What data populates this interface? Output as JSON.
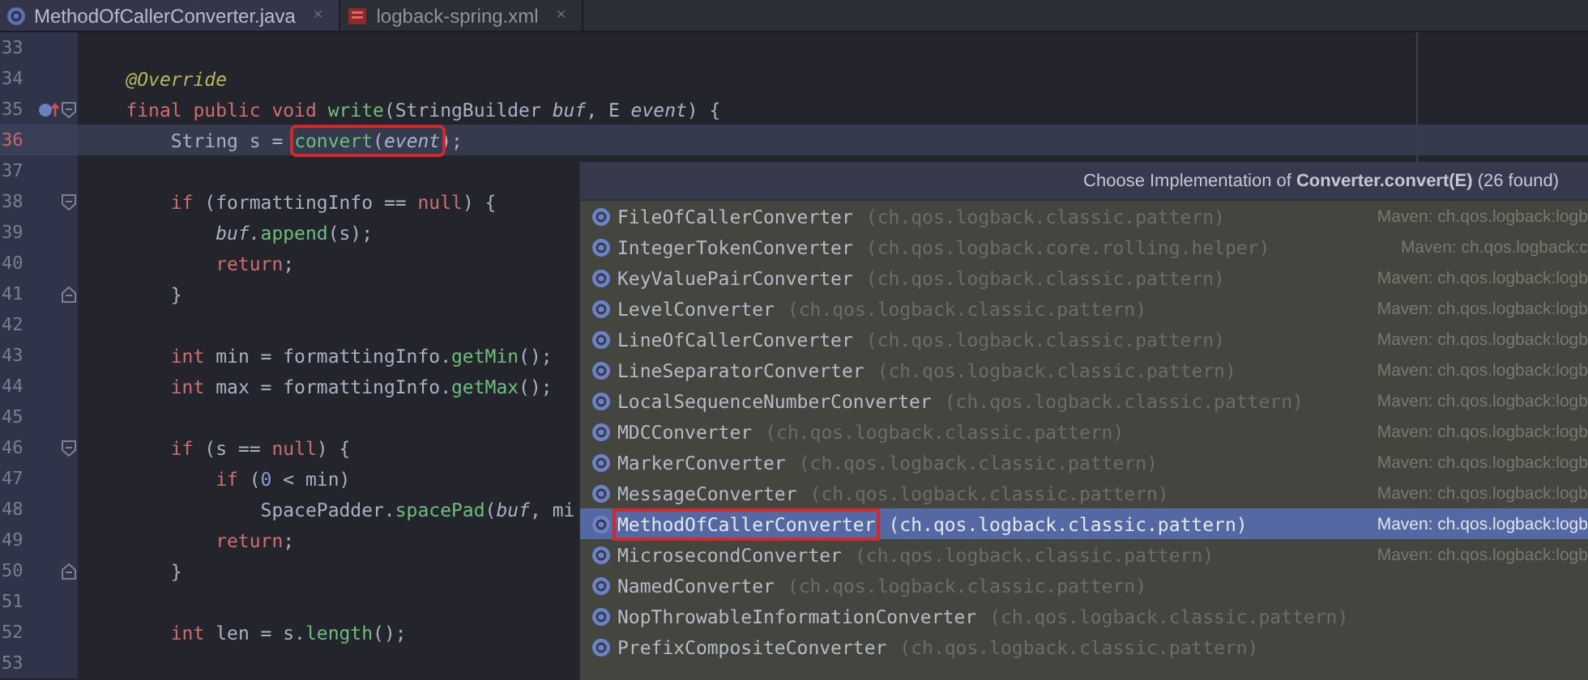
{
  "tabs": [
    {
      "label": "MethodOfCallerConverter.java",
      "kind": "class",
      "selected": true,
      "close": "×"
    },
    {
      "label": "logback-spring.xml",
      "kind": "xml",
      "selected": false,
      "close": "×"
    }
  ],
  "lines": [
    {
      "number": "33",
      "current": false
    },
    {
      "number": "34",
      "current": false,
      "tokens": [
        {
          "text": "    @Override",
          "kind": "annotation"
        }
      ]
    },
    {
      "number": "35",
      "current": false,
      "override": true,
      "fold_open": true,
      "tokens": [
        {
          "text": "    final public void ",
          "kind": "keyword"
        },
        {
          "text": "write",
          "kind": "method"
        },
        {
          "text": "(StringBuilder ",
          "kind": "plain"
        },
        {
          "text": "buf",
          "kind": "param"
        },
        {
          "text": ", E ",
          "kind": "plain"
        },
        {
          "text": "event",
          "kind": "param"
        },
        {
          "text": ") {",
          "kind": "plain"
        }
      ]
    },
    {
      "number": "36",
      "current": true,
      "tokens": [
        {
          "text": "        String s = ",
          "kind": "plain"
        },
        {
          "text": "convert",
          "kind": "method",
          "boxed": true
        },
        {
          "text": "(",
          "kind": "plain",
          "boxed": true
        },
        {
          "text": "event",
          "kind": "param",
          "boxed": true
        },
        {
          "text": ");",
          "kind": "plain"
        }
      ]
    },
    {
      "number": "37",
      "current": false
    },
    {
      "number": "38",
      "current": false,
      "fold_open": true,
      "tokens": [
        {
          "text": "        if ",
          "kind": "keyword"
        },
        {
          "text": "(formattingInfo == ",
          "kind": "plain"
        },
        {
          "text": "null",
          "kind": "keyword"
        },
        {
          "text": ") {",
          "kind": "plain"
        }
      ]
    },
    {
      "number": "39",
      "current": false,
      "tokens": [
        {
          "text": "            buf.",
          "kind": "param"
        },
        {
          "text": "append",
          "kind": "method"
        },
        {
          "text": "(s);",
          "kind": "plain"
        }
      ]
    },
    {
      "number": "40",
      "current": false,
      "tokens": [
        {
          "text": "            return",
          "kind": "keyword"
        },
        {
          "text": ";",
          "kind": "plain"
        }
      ]
    },
    {
      "number": "41",
      "current": false,
      "fold_close": true,
      "tokens": [
        {
          "text": "        }",
          "kind": "plain"
        }
      ]
    },
    {
      "number": "42",
      "current": false
    },
    {
      "number": "43",
      "current": false,
      "tokens": [
        {
          "text": "        int ",
          "kind": "keyword"
        },
        {
          "text": "min = formattingInfo.",
          "kind": "plain"
        },
        {
          "text": "getMin",
          "kind": "method"
        },
        {
          "text": "();",
          "kind": "plain"
        }
      ]
    },
    {
      "number": "44",
      "current": false,
      "tokens": [
        {
          "text": "        int ",
          "kind": "keyword"
        },
        {
          "text": "max = formattingInfo.",
          "kind": "plain"
        },
        {
          "text": "getMax",
          "kind": "method"
        },
        {
          "text": "();",
          "kind": "plain"
        }
      ]
    },
    {
      "number": "45",
      "current": false
    },
    {
      "number": "46",
      "current": false,
      "fold_open": true,
      "tokens": [
        {
          "text": "        if ",
          "kind": "keyword"
        },
        {
          "text": "(s == ",
          "kind": "plain"
        },
        {
          "text": "null",
          "kind": "keyword"
        },
        {
          "text": ") {",
          "kind": "plain"
        }
      ]
    },
    {
      "number": "47",
      "current": false,
      "tokens": [
        {
          "text": "            if ",
          "kind": "keyword"
        },
        {
          "text": "(",
          "kind": "plain"
        },
        {
          "text": "0",
          "kind": "number"
        },
        {
          "text": " < min)",
          "kind": "plain"
        }
      ]
    },
    {
      "number": "48",
      "current": false,
      "tokens": [
        {
          "text": "                SpacePadder.",
          "kind": "plain"
        },
        {
          "text": "spacePad",
          "kind": "method"
        },
        {
          "text": "(",
          "kind": "plain"
        },
        {
          "text": "buf",
          "kind": "param"
        },
        {
          "text": ", mi",
          "kind": "plain"
        }
      ]
    },
    {
      "number": "49",
      "current": false,
      "tokens": [
        {
          "text": "            return",
          "kind": "keyword"
        },
        {
          "text": ";",
          "kind": "plain"
        }
      ]
    },
    {
      "number": "50",
      "current": false,
      "fold_close": true,
      "tokens": [
        {
          "text": "        }",
          "kind": "plain"
        }
      ]
    },
    {
      "number": "51",
      "current": false
    },
    {
      "number": "52",
      "current": false,
      "tokens": [
        {
          "text": "        int ",
          "kind": "keyword"
        },
        {
          "text": "len = s.",
          "kind": "plain"
        },
        {
          "text": "length",
          "kind": "method"
        },
        {
          "text": "();",
          "kind": "plain"
        }
      ]
    },
    {
      "number": "53",
      "current": false
    }
  ],
  "popup": {
    "title": "Choose Implementation of **Converter.convert(E)** (26 found)",
    "items": [
      {
        "name": "FileOfCallerConverter",
        "package": "(ch.qos.logback.classic.pattern)",
        "source": "Maven: ch.qos.logback:logb",
        "selected": false
      },
      {
        "name": "IntegerTokenConverter",
        "package": "(ch.qos.logback.core.rolling.helper)",
        "source": "Maven: ch.qos.logback:c",
        "selected": false
      },
      {
        "name": "KeyValuePairConverter",
        "package": "(ch.qos.logback.classic.pattern)",
        "source": "Maven: ch.qos.logback:logb",
        "selected": false
      },
      {
        "name": "LevelConverter",
        "package": "(ch.qos.logback.classic.pattern)",
        "source": "Maven: ch.qos.logback:logb",
        "selected": false
      },
      {
        "name": "LineOfCallerConverter",
        "package": "(ch.qos.logback.classic.pattern)",
        "source": "Maven: ch.qos.logback:logb",
        "selected": false
      },
      {
        "name": "LineSeparatorConverter",
        "package": "(ch.qos.logback.classic.pattern)",
        "source": "Maven: ch.qos.logback:logb",
        "selected": false
      },
      {
        "name": "LocalSequenceNumberConverter",
        "package": "(ch.qos.logback.classic.pattern)",
        "source": "Maven: ch.qos.logback:logb",
        "selected": false
      },
      {
        "name": "MDCConverter",
        "package": "(ch.qos.logback.classic.pattern)",
        "source": "Maven: ch.qos.logback:logb",
        "selected": false
      },
      {
        "name": "MarkerConverter",
        "package": "(ch.qos.logback.classic.pattern)",
        "source": "Maven: ch.qos.logback:logb",
        "selected": false
      },
      {
        "name": "MessageConverter",
        "package": "(ch.qos.logback.classic.pattern)",
        "source": "Maven: ch.qos.logback:logb",
        "selected": false
      },
      {
        "name": "MethodOfCallerConverter",
        "package": "(ch.qos.logback.classic.pattern)",
        "source": "Maven: ch.qos.logback:logb",
        "selected": true,
        "boxed": true
      },
      {
        "name": "MicrosecondConverter",
        "package": "(ch.qos.logback.classic.pattern)",
        "source": "Maven: ch.qos.logback:logb",
        "selected": false
      },
      {
        "name": "NamedConverter",
        "package": "(ch.qos.logback.classic.pattern)",
        "selected": false
      },
      {
        "name": "NopThrowableInformationConverter",
        "package": "(ch.qos.logback.classic.pattern)",
        "selected": false
      },
      {
        "name": "PrefixCompositeConverter",
        "package": "(ch.qos.logback.classic.pattern)",
        "selected": false
      }
    ]
  }
}
